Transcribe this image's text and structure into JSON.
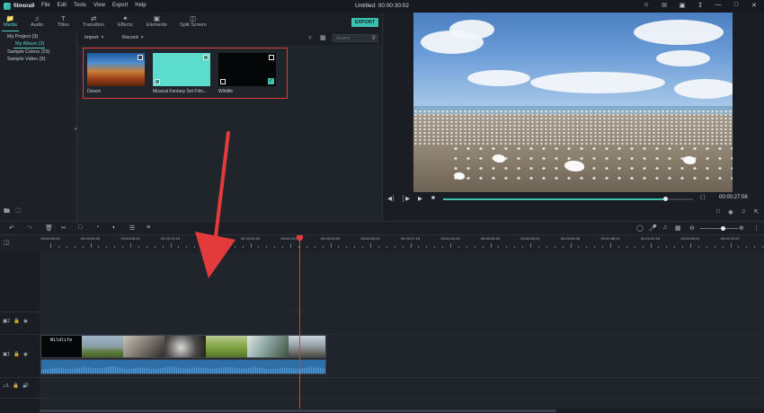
{
  "app": {
    "logo": "filmora9",
    "window_title": "Untitled:",
    "window_time": "00:00:30:02"
  },
  "menu": [
    "File",
    "Edit",
    "Tools",
    "View",
    "Export",
    "Help"
  ],
  "window_controls": [
    "user-icon",
    "notification-icon",
    "save-icon",
    "download-icon",
    "minimize-icon",
    "restore-icon",
    "close-icon"
  ],
  "top_tabs": [
    {
      "label": "Media",
      "icon": "folder-icon"
    },
    {
      "label": "Audio",
      "icon": "music-note-icon"
    },
    {
      "label": "Titles",
      "icon": "text-icon"
    },
    {
      "label": "Transition",
      "icon": "transition-icon"
    },
    {
      "label": "Effects",
      "icon": "effects-icon"
    },
    {
      "label": "Elements",
      "icon": "image-icon"
    },
    {
      "label": "Split Screen",
      "icon": "split-screen-icon"
    }
  ],
  "export_label": "EXPORT",
  "tree": {
    "project": "My Project (3)",
    "album": "My Album (3)",
    "colors": "Sample Colors (15)",
    "video": "Sample Video (9)"
  },
  "media_bar": {
    "import": "Import",
    "record": "Record",
    "search_placeholder": "Search"
  },
  "media_items": [
    {
      "caption": "Desert"
    },
    {
      "caption": "Musical Fantasy Set Film..."
    },
    {
      "caption": "Wildlife"
    }
  ],
  "preview": {
    "time": "00:00:27:08",
    "progress": 0.89,
    "braces": "{ }"
  },
  "timeline": {
    "ruler_labels": [
      "00:00:00:00",
      "00:00:04:05",
      "00:00:08:10",
      "00:00:12:15",
      "00:00:16:20",
      "00:00:20:25",
      "00:00:25:00",
      "00:00:29:05",
      "00:00:33:10",
      "00:00:37:15",
      "00:00:41:20",
      "00:00:45:25",
      "00:00:50:01",
      "00:00:54:06",
      "00:00:58:11",
      "00:01:02:16",
      "00:01:06:21",
      "00:01:10:27"
    ],
    "track_video2": "2",
    "track_video1": "1",
    "track_audio1": "1",
    "clip_title": "Wildlife",
    "zoom": 0.6
  },
  "colors": {
    "accent": "#3dc0b0",
    "highlight": "#e33b3b"
  }
}
